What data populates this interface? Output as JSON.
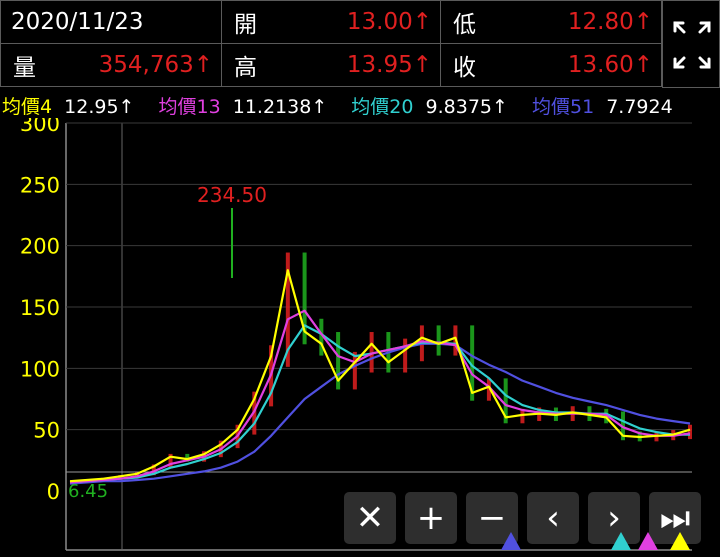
{
  "header": {
    "date": "2020/11/23",
    "open_label": "開",
    "open_value": "13.00↑",
    "low_label": "低",
    "low_value": "12.80↑",
    "volume_label": "量",
    "volume_value": "354,763↑",
    "high_label": "高",
    "high_value": "13.95↑",
    "close_label": "收",
    "close_value": "13.60↑"
  },
  "moving_averages": [
    {
      "label": "均價4",
      "value": "12.95↑",
      "color": "#ffff00"
    },
    {
      "label": "均價13",
      "value": "11.2138↑",
      "color": "#e040e0"
    },
    {
      "label": "均價20",
      "value": "9.8375↑",
      "color": "#30d0d0"
    },
    {
      "label": "均價51",
      "value": "7.7924",
      "color": "#5050e0"
    }
  ],
  "chart_data": {
    "type": "line",
    "y_ticks": [
      "300",
      "250",
      "200",
      "150",
      "100",
      "50",
      "0"
    ],
    "ylim": [
      0,
      300
    ],
    "max_label": "234.50",
    "min_label": "6.45",
    "grid": true,
    "series": [
      {
        "color": "#ffff00",
        "values": [
          8,
          9,
          10,
          12,
          14,
          20,
          28,
          26,
          30,
          38,
          50,
          75,
          110,
          180,
          130,
          120,
          90,
          105,
          120,
          105,
          115,
          125,
          120,
          125,
          80,
          85,
          60,
          62,
          63,
          62,
          64,
          62,
          60,
          45,
          44,
          45,
          46,
          50
        ]
      },
      {
        "color": "#e040e0",
        "values": [
          7,
          8,
          9,
          10,
          12,
          16,
          22,
          25,
          28,
          34,
          45,
          65,
          95,
          140,
          147,
          128,
          110,
          105,
          112,
          115,
          118,
          122,
          121,
          119,
          95,
          85,
          70,
          66,
          64,
          63,
          63,
          63,
          62,
          52,
          47,
          45,
          45,
          47
        ]
      },
      {
        "color": "#30d0d0",
        "values": [
          7,
          8,
          9,
          10,
          11,
          14,
          19,
          22,
          26,
          31,
          40,
          55,
          80,
          115,
          135,
          128,
          118,
          110,
          112,
          115,
          118,
          121,
          121,
          120,
          102,
          92,
          78,
          70,
          66,
          64,
          64,
          63,
          63,
          57,
          51,
          48,
          46,
          46
        ]
      },
      {
        "color": "#5050e0",
        "values": [
          6,
          7,
          8,
          8,
          9,
          10,
          12,
          14,
          16,
          19,
          24,
          32,
          45,
          60,
          75,
          85,
          95,
          102,
          108,
          113,
          117,
          120,
          120,
          119,
          110,
          103,
          97,
          90,
          85,
          80,
          76,
          73,
          70,
          66,
          62,
          59,
          57,
          55
        ]
      }
    ]
  },
  "controls": [
    {
      "name": "close-button",
      "symbol": "✕"
    },
    {
      "name": "zoom-in-button",
      "symbol": "+"
    },
    {
      "name": "zoom-out-button",
      "symbol": "−"
    },
    {
      "name": "prev-button",
      "symbol": "‹"
    },
    {
      "name": "next-button",
      "symbol": "›"
    },
    {
      "name": "last-button",
      "symbol": "⏭"
    }
  ]
}
